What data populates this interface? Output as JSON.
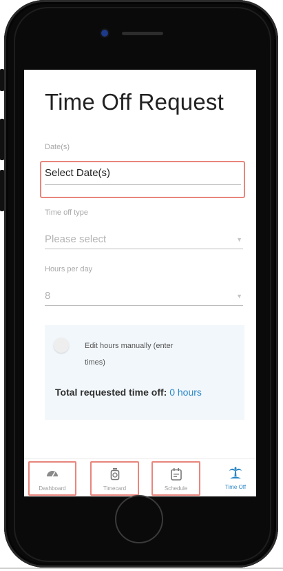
{
  "page": {
    "title": "Time Off Request"
  },
  "form": {
    "dates_label": "Date(s)",
    "dates_value": "Select Date(s)",
    "type_label": "Time off type",
    "type_placeholder": "Please select",
    "hours_label": "Hours per day",
    "hours_value": "8",
    "manual_toggle_label": "Edit hours manually (enter times)",
    "manual_toggle_on": false,
    "total_label": "Total requested time off:",
    "total_value": "0 hours"
  },
  "nav": {
    "items": [
      {
        "label": "Dashboard",
        "icon": "gauge-icon",
        "highlighted": true,
        "active": false
      },
      {
        "label": "Timecard",
        "icon": "stopwatch-icon",
        "highlighted": true,
        "active": false
      },
      {
        "label": "Schedule",
        "icon": "calendar-icon",
        "highlighted": true,
        "active": false
      },
      {
        "label": "Time Off",
        "icon": "palm-tree-icon",
        "highlighted": false,
        "active": true
      }
    ]
  },
  "colors": {
    "accent": "#2b86c5",
    "highlight": "#e8857c",
    "phone_frame": "#0a0a0a",
    "panel_bg": "#f2f7fb"
  }
}
